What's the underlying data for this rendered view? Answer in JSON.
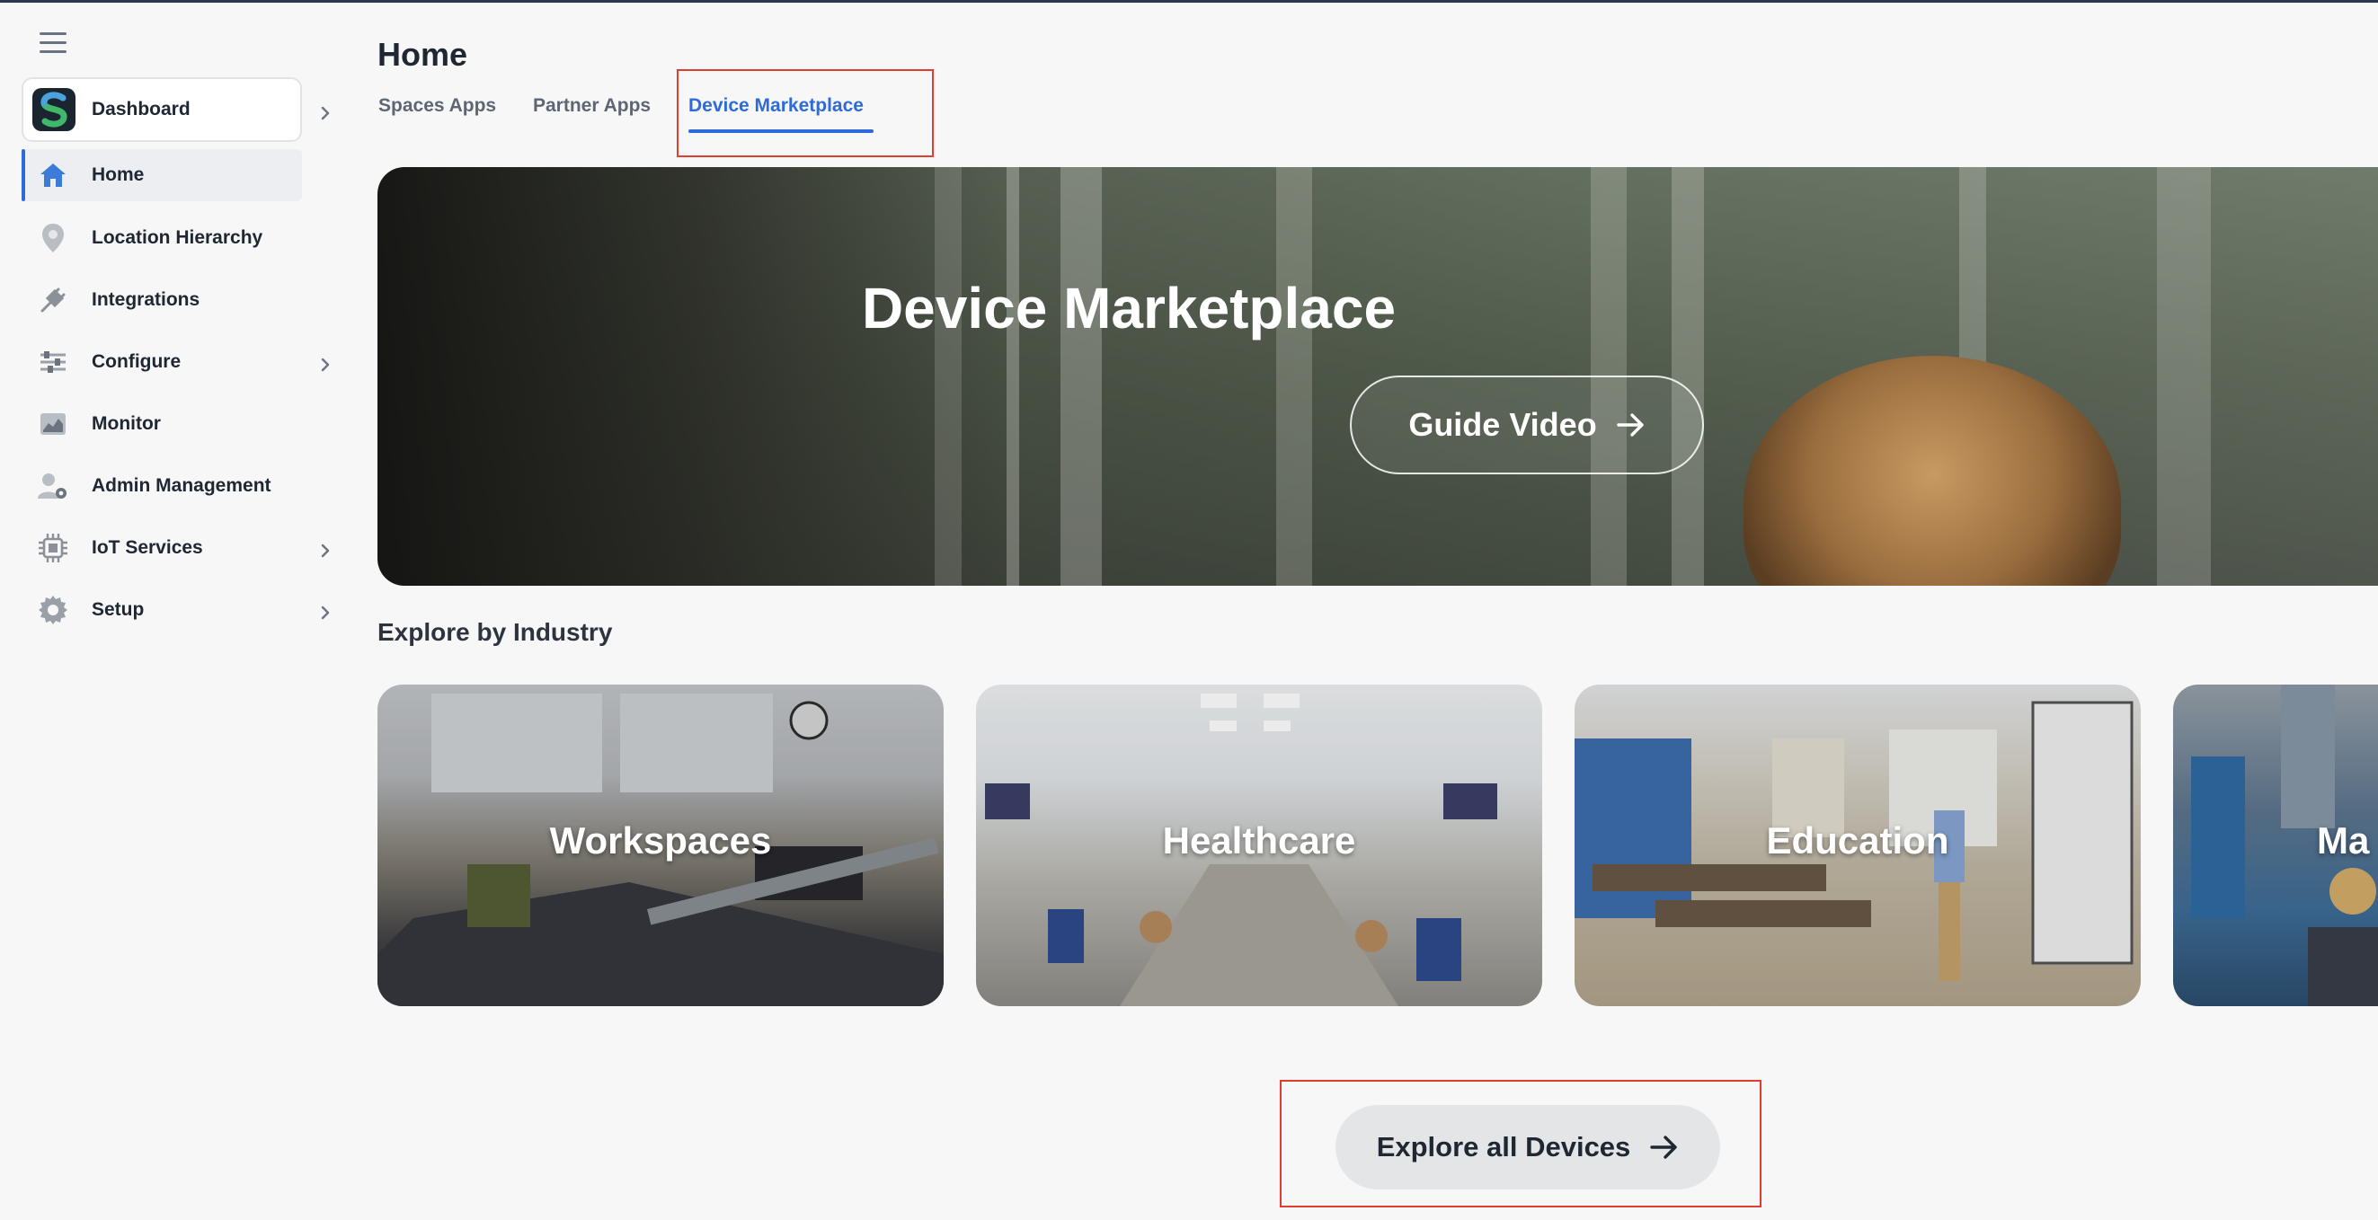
{
  "sidebar": {
    "dashboard_label": "Dashboard",
    "items": [
      {
        "label": "Home",
        "icon": "home-icon",
        "active": true
      },
      {
        "label": "Location Hierarchy",
        "icon": "location-pin-icon"
      },
      {
        "label": "Integrations",
        "icon": "plug-icon"
      },
      {
        "label": "Configure",
        "icon": "sliders-icon",
        "has_submenu": true
      },
      {
        "label": "Monitor",
        "icon": "monitor-chart-icon"
      },
      {
        "label": "Admin Management",
        "icon": "admin-user-icon"
      },
      {
        "label": "IoT Services",
        "icon": "chip-icon",
        "has_submenu": true
      },
      {
        "label": "Setup",
        "icon": "gear-icon",
        "has_submenu": true
      }
    ]
  },
  "header": {
    "title": "Home",
    "tabs": [
      {
        "label": "Spaces Apps"
      },
      {
        "label": "Partner Apps"
      },
      {
        "label": "Device Marketplace",
        "active": true
      }
    ]
  },
  "hero": {
    "title": "Device Marketplace",
    "button_label": "Guide Video"
  },
  "industries": {
    "title": "Explore by Industry",
    "cards": [
      {
        "label": "Workspaces"
      },
      {
        "label": "Healthcare"
      },
      {
        "label": "Education"
      },
      {
        "label": "Ma"
      }
    ]
  },
  "explore_button": {
    "label": "Explore all Devices"
  },
  "colors": {
    "accent": "#2f6bd8",
    "annotation": "#e13d2e",
    "background": "#f7f7f7"
  }
}
